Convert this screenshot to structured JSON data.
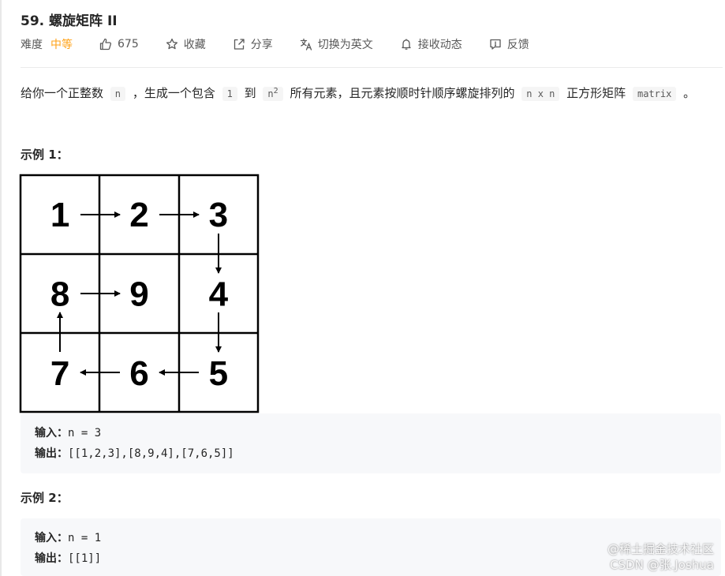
{
  "problem": {
    "title": "59. 螺旋矩阵 II",
    "difficulty_label": "难度",
    "difficulty_value": "中等",
    "likes": "675",
    "favorite_label": "收藏",
    "share_label": "分享",
    "switch_lang_label": "切换为英文",
    "follow_label": "接收动态",
    "feedback_label": "反馈"
  },
  "description": {
    "t1": "给你一个正整数",
    "c1": "n",
    "t2": "，生成一个包含",
    "c2": "1",
    "t3": "到",
    "c3": "n",
    "sup": "2",
    "t4": "所有元素，且元素按顺时针顺序螺旋排列的",
    "c4": "n x n",
    "t5": "正方形矩阵",
    "c5": "matrix",
    "t6": "。"
  },
  "example1": {
    "title": "示例 1：",
    "matrix": [
      [
        "1",
        "2",
        "3"
      ],
      [
        "8",
        "9",
        "4"
      ],
      [
        "7",
        "6",
        "5"
      ]
    ],
    "input_label": "输入：",
    "input_value": "n = 3",
    "output_label": "输出：",
    "output_value": "[[1,2,3],[8,9,4],[7,6,5]]"
  },
  "example2": {
    "title": "示例 2：",
    "input_label": "输入：",
    "input_value": "n = 1",
    "output_label": "输出：",
    "output_value": "[[1]]"
  },
  "watermark": {
    "line1": "@稀土掘金技术社区",
    "line2": "CSDN @张.Joshua"
  },
  "colors": {
    "accent_orange": "#ffa116",
    "code_bg": "#f7f8fa"
  },
  "icons": [
    "thumbs-up-icon",
    "star-icon",
    "share-icon",
    "translate-icon",
    "bell-icon",
    "feedback-icon"
  ]
}
